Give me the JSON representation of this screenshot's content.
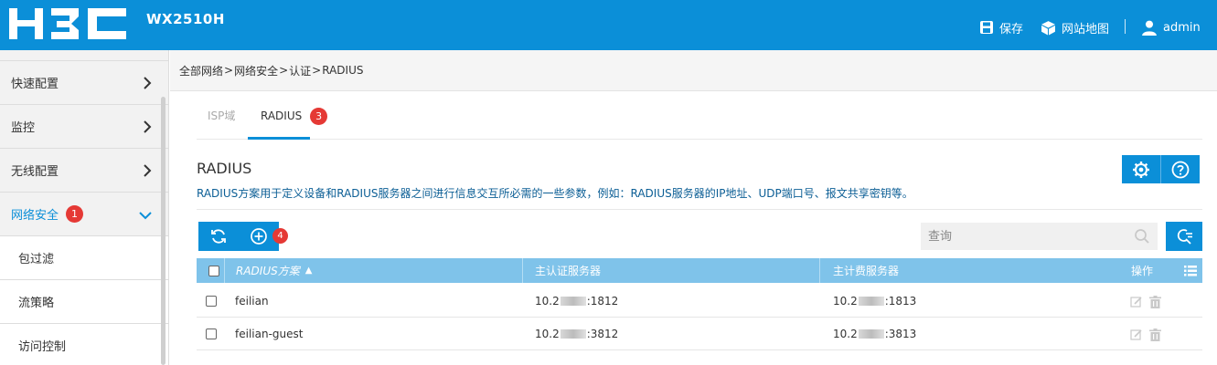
{
  "header": {
    "logo_text": "H3C",
    "model": "WX2510H",
    "save_label": "保存",
    "sitemap_label": "网站地图",
    "user_label": "admin",
    "bg_color": "#0b8fd8"
  },
  "sidebar": {
    "items": [
      {
        "label": "快速配置",
        "icon": "chevron-right-icon"
      },
      {
        "label": "监控",
        "icon": "chevron-right-icon"
      },
      {
        "label": "无线配置",
        "icon": "chevron-right-icon"
      },
      {
        "label": "网络安全",
        "icon": "chevron-down-icon",
        "badge": "1",
        "active": true
      }
    ],
    "subitems": [
      {
        "label": "包过滤"
      },
      {
        "label": "流策略"
      },
      {
        "label": "访问控制"
      }
    ]
  },
  "breadcrumb": [
    "全部网络",
    "网络安全",
    "认证",
    "RADIUS"
  ],
  "breadcrumb_separator": ">",
  "tabs": [
    {
      "label": "ISP域"
    },
    {
      "label": "RADIUS",
      "badge": "3",
      "active": true
    }
  ],
  "section": {
    "title": "RADIUS",
    "description": "RADIUS方案用于定义设备和RADIUS服务器之间进行信息交互所必需的一些参数，例如：RADIUS服务器的IP地址、UDP端口号、报文共享密钥等。"
  },
  "toolbar": {
    "refresh_icon": "refresh-icon",
    "add_icon": "add-circle-icon",
    "add_badge": "4",
    "search_placeholder": "查询"
  },
  "table": {
    "columns": [
      "RADIUS方案",
      "主认证服务器",
      "主计费服务器",
      "操作"
    ],
    "sort_indicator": "▲",
    "rows": [
      {
        "name": "feilian",
        "auth_prefix": "10.2",
        "auth_suffix": ":1812",
        "acct_prefix": "10.2",
        "acct_suffix": ":1813"
      },
      {
        "name": "feilian-guest",
        "auth_prefix": "10.2",
        "auth_suffix": ":3812",
        "acct_prefix": "10.2",
        "acct_suffix": ":3813"
      }
    ]
  }
}
